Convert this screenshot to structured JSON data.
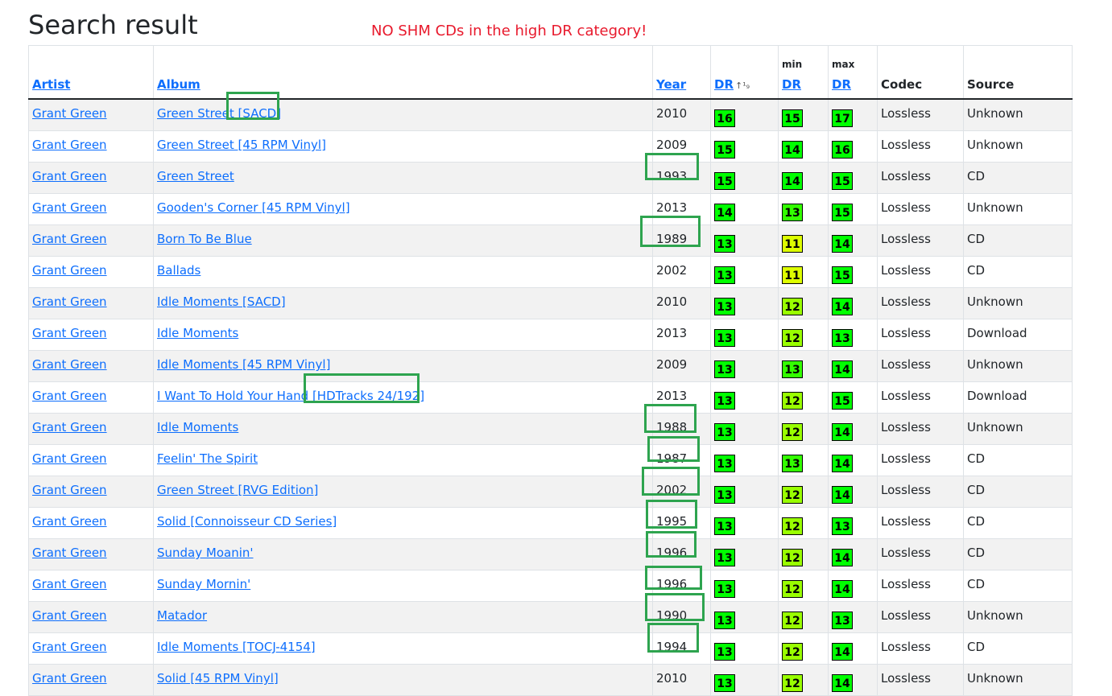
{
  "page": {
    "title": "Search result",
    "annotation": "NO SHM CDs in the high DR category!"
  },
  "table": {
    "columns": {
      "artist": "Artist",
      "album": "Album",
      "year": "Year",
      "dr": "DR",
      "min_label": "min",
      "min_dr": "DR",
      "max_label": "max",
      "max_dr": "DR",
      "codec": "Codec",
      "source": "Source"
    },
    "rows": [
      {
        "artist": "Grant Green",
        "album": "Green Street [SACD]",
        "year": "2010",
        "dr": "16",
        "min": "15",
        "max": "17",
        "codec": "Lossless",
        "source": "Unknown"
      },
      {
        "artist": "Grant Green",
        "album": "Green Street [45 RPM Vinyl]",
        "year": "2009",
        "dr": "15",
        "min": "14",
        "max": "16",
        "codec": "Lossless",
        "source": "Unknown"
      },
      {
        "artist": "Grant Green",
        "album": "Green Street",
        "year": "1993",
        "dr": "15",
        "min": "14",
        "max": "15",
        "codec": "Lossless",
        "source": "CD"
      },
      {
        "artist": "Grant Green",
        "album": "Gooden's Corner [45 RPM Vinyl]",
        "year": "2013",
        "dr": "14",
        "min": "13",
        "max": "15",
        "codec": "Lossless",
        "source": "Unknown"
      },
      {
        "artist": "Grant Green",
        "album": "Born To Be Blue",
        "year": "1989",
        "dr": "13",
        "min": "11",
        "max": "14",
        "codec": "Lossless",
        "source": "CD"
      },
      {
        "artist": "Grant Green",
        "album": "Ballads",
        "year": "2002",
        "dr": "13",
        "min": "11",
        "max": "15",
        "codec": "Lossless",
        "source": "CD"
      },
      {
        "artist": "Grant Green",
        "album": "Idle Moments [SACD]",
        "year": "2010",
        "dr": "13",
        "min": "12",
        "max": "14",
        "codec": "Lossless",
        "source": "Unknown"
      },
      {
        "artist": "Grant Green",
        "album": "Idle Moments",
        "year": "2013",
        "dr": "13",
        "min": "12",
        "max": "13",
        "codec": "Lossless",
        "source": "Download"
      },
      {
        "artist": "Grant Green",
        "album": "Idle Moments [45 RPM Vinyl]",
        "year": "2009",
        "dr": "13",
        "min": "13",
        "max": "14",
        "codec": "Lossless",
        "source": "Unknown"
      },
      {
        "artist": "Grant Green",
        "album": "I Want To Hold Your Hand [HDTracks 24/192]",
        "year": "2013",
        "dr": "13",
        "min": "12",
        "max": "15",
        "codec": "Lossless",
        "source": "Download"
      },
      {
        "artist": "Grant Green",
        "album": "Idle Moments",
        "year": "1988",
        "dr": "13",
        "min": "12",
        "max": "14",
        "codec": "Lossless",
        "source": "Unknown"
      },
      {
        "artist": "Grant Green",
        "album": "Feelin' The Spirit",
        "year": "1987",
        "dr": "13",
        "min": "13",
        "max": "14",
        "codec": "Lossless",
        "source": "CD"
      },
      {
        "artist": "Grant Green",
        "album": "Green Street [RVG Edition]",
        "year": "2002",
        "dr": "13",
        "min": "12",
        "max": "14",
        "codec": "Lossless",
        "source": "CD"
      },
      {
        "artist": "Grant Green",
        "album": "Solid [Connoisseur CD Series]",
        "year": "1995",
        "dr": "13",
        "min": "12",
        "max": "13",
        "codec": "Lossless",
        "source": "CD"
      },
      {
        "artist": "Grant Green",
        "album": "Sunday Moanin'",
        "year": "1996",
        "dr": "13",
        "min": "12",
        "max": "14",
        "codec": "Lossless",
        "source": "CD"
      },
      {
        "artist": "Grant Green",
        "album": "Sunday Mornin'",
        "year": "1996",
        "dr": "13",
        "min": "12",
        "max": "14",
        "codec": "Lossless",
        "source": "CD"
      },
      {
        "artist": "Grant Green",
        "album": "Matador",
        "year": "1990",
        "dr": "13",
        "min": "12",
        "max": "13",
        "codec": "Lossless",
        "source": "Unknown"
      },
      {
        "artist": "Grant Green",
        "album": "Idle Moments [TOCJ-4154]",
        "year": "1994",
        "dr": "13",
        "min": "12",
        "max": "14",
        "codec": "Lossless",
        "source": "CD"
      },
      {
        "artist": "Grant Green",
        "album": "Solid [45 RPM Vinyl]",
        "year": "2010",
        "dr": "13",
        "min": "12",
        "max": "14",
        "codec": "Lossless",
        "source": "Unknown"
      }
    ]
  },
  "dr_colors": {
    "16": "#00ff00",
    "17": "#00ff00",
    "15": "#00ff00",
    "14": "#00ff00",
    "13": "#00ff00",
    "12": "#99ff00",
    "11": "#ddff00"
  },
  "min_colors": {
    "15": "#00ff00",
    "14": "#00ff00",
    "13": "#33ff00",
    "12": "#99ff00",
    "11": "#ddff00"
  },
  "highlight_color": "#2ea44f",
  "icons": {
    "sort": "sort-numeric-icon"
  }
}
